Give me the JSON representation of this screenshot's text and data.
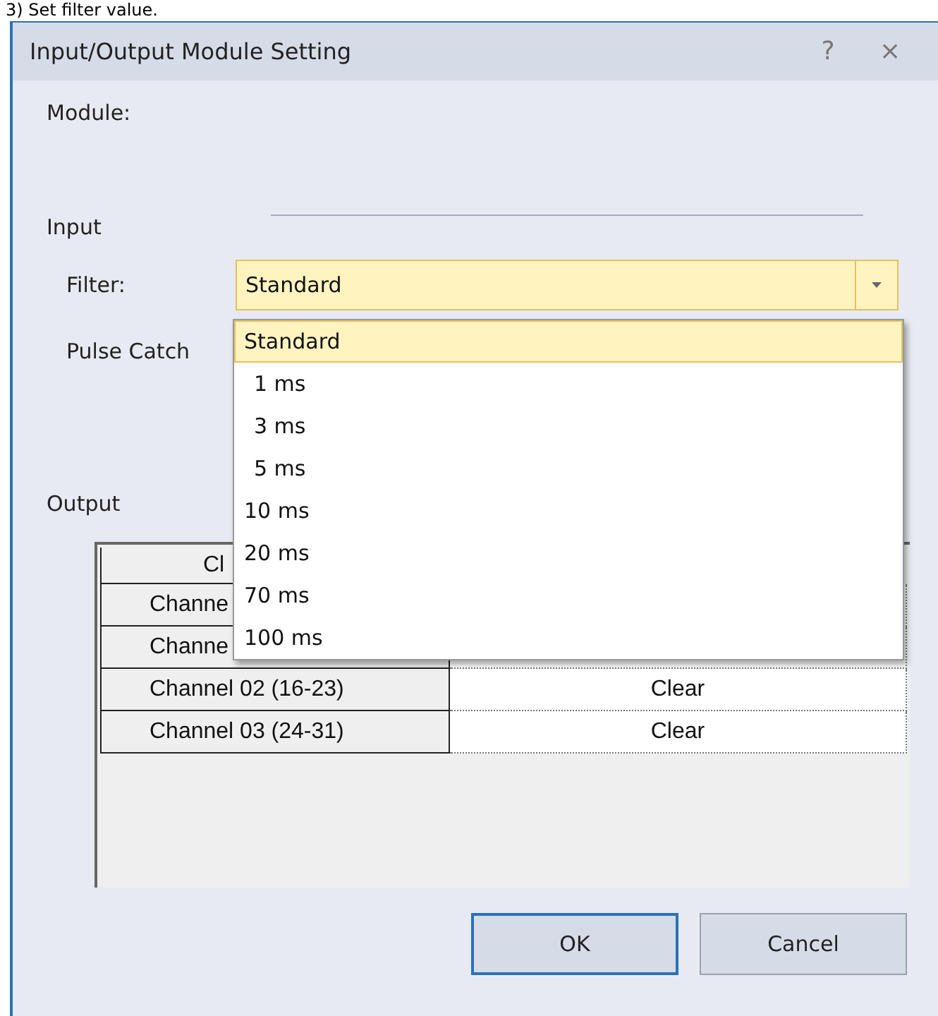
{
  "caption": "3) Set filter value.",
  "window": {
    "title": "Input/Output Module Setting",
    "help": "?",
    "close": "×"
  },
  "module_label": "Module:",
  "input": {
    "title": "Input",
    "filter_label": "Filter:",
    "filter_value": "Standard",
    "pulse_catch_label": "Pulse Catch",
    "options": [
      {
        "label": "Standard",
        "selected": true
      },
      {
        "label": "1 ms",
        "selected": false
      },
      {
        "label": "3 ms",
        "selected": false
      },
      {
        "label": "5 ms",
        "selected": false
      },
      {
        "label": "10 ms",
        "selected": false
      },
      {
        "label": "20 ms",
        "selected": false
      },
      {
        "label": "70 ms",
        "selected": false
      },
      {
        "label": "100 ms",
        "selected": false
      }
    ]
  },
  "output": {
    "title": "Output",
    "column_1": "Cl",
    "rows": [
      {
        "channel": "Channe",
        "value": ""
      },
      {
        "channel": "Channe",
        "value": ""
      },
      {
        "channel": "Channel 02 (16-23)",
        "value": "Clear"
      },
      {
        "channel": "Channel 03 (24-31)",
        "value": "Clear"
      }
    ]
  },
  "buttons": [
    {
      "label": "OK",
      "default": true
    },
    {
      "label": "Cancel",
      "default": false
    }
  ]
}
